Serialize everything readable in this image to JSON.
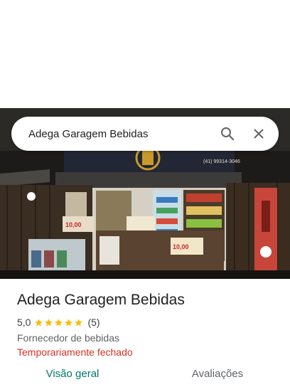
{
  "search": {
    "query": "Adega Garagem Bebidas"
  },
  "place": {
    "name": "Adega Garagem Bebidas",
    "rating": "5,0",
    "stars": 5,
    "review_count": "(5)",
    "category": "Fornecedor de bebidas",
    "status": "Temporariamente fechado"
  },
  "photo": {
    "sign_phone": "(41) 99314-3046",
    "banner_price": "10,00"
  },
  "tabs": [
    {
      "label": "Visão geral",
      "active": true
    },
    {
      "label": "Avaliações",
      "active": false
    }
  ],
  "colors": {
    "accent": "#00776a",
    "star": "#fbbc04",
    "status_closed": "#d93025"
  },
  "icons": [
    "search-icon",
    "close-icon",
    "star-icon"
  ]
}
